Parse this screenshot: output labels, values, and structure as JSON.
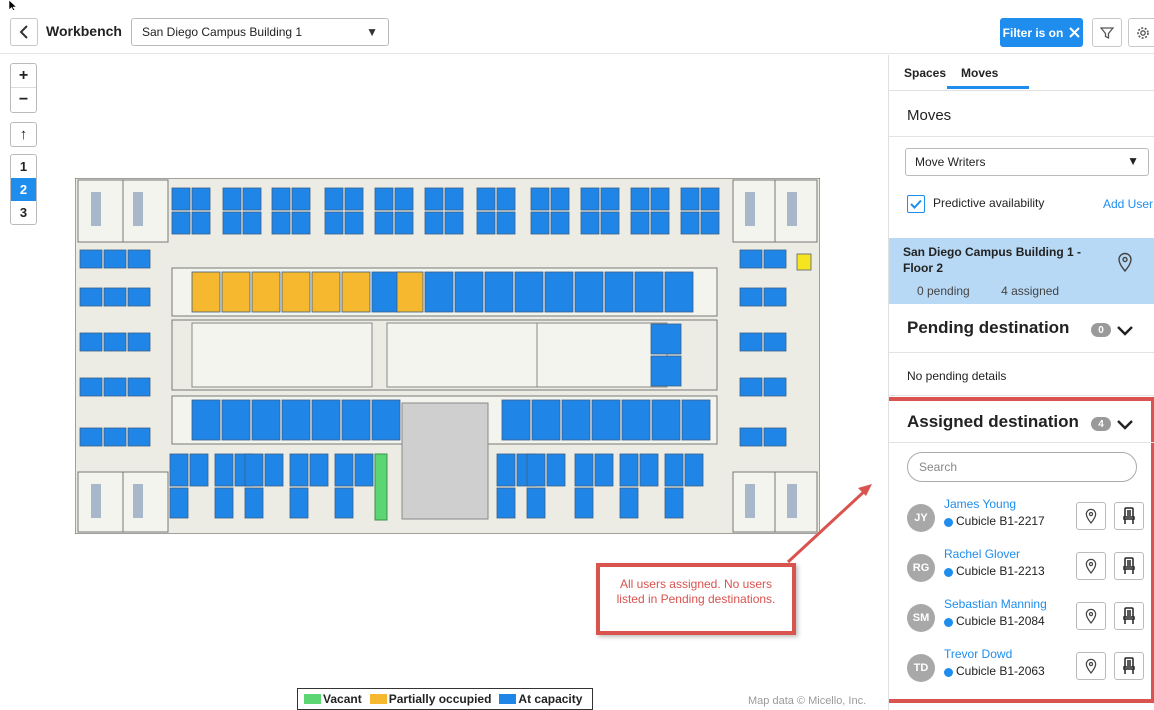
{
  "header": {
    "title": "Workbench",
    "building": "San Diego Campus Building 1",
    "filter_label": "Filter is on"
  },
  "map": {
    "zoom_in": "+",
    "zoom_out": "−",
    "north": "↑",
    "floors": [
      "1",
      "2",
      "3"
    ],
    "active_floor": "2",
    "legend": [
      {
        "label": "Vacant",
        "color": "#5cd672"
      },
      {
        "label": "Partially occupied",
        "color": "#f5b82e"
      },
      {
        "label": "At capacity",
        "color": "#1f85e6"
      }
    ],
    "attribution": "Map data © Micello, Inc."
  },
  "callout": {
    "text": "All users assigned. No users listed in Pending destinations."
  },
  "panel": {
    "tabs": [
      "Spaces",
      "Moves"
    ],
    "active_tab": "Moves",
    "section_title": "Moves",
    "group_select": "Move Writers",
    "predictive_label": "Predictive availability",
    "add_user": "Add User",
    "building_card": {
      "name": "San Diego Campus Building 1 - Floor 2",
      "pending": "0 pending",
      "assigned": "4 assigned"
    },
    "pending": {
      "title": "Pending destination",
      "count": "0",
      "empty_text": "No pending details"
    },
    "assigned": {
      "title": "Assigned destination",
      "count": "4",
      "search_placeholder": "Search",
      "users": [
        {
          "initials": "JY",
          "name": "James Young",
          "cubicle": "Cubicle B1-2217"
        },
        {
          "initials": "RG",
          "name": "Rachel Glover",
          "cubicle": "Cubicle B1-2213"
        },
        {
          "initials": "SM",
          "name": "Sebastian Manning",
          "cubicle": "Cubicle B1-2084"
        },
        {
          "initials": "TD",
          "name": "Trevor Dowd",
          "cubicle": "Cubicle B1-2063"
        }
      ]
    }
  },
  "colors": {
    "accent": "#1f8ded",
    "vacant": "#5cd672",
    "partial": "#f5b82e",
    "capacity": "#1f85e6",
    "annotation": "#d9534f"
  }
}
